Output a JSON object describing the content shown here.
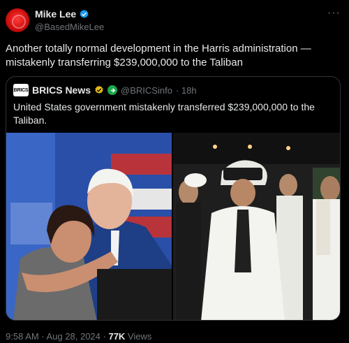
{
  "author": {
    "display_name": "Mike Lee",
    "handle": "@BasedMikeLee"
  },
  "more_icon": "ellipsis-icon",
  "tweet": {
    "text": "Another totally normal development in the Harris administration — mistakenly transferring $239,000,000 to the Taliban"
  },
  "quote": {
    "avatar_text": "BRICS",
    "name": "BRICS News",
    "handle": "@BRICSinfo",
    "time": "· 18h",
    "text": "United States government mistakenly transferred $239,000,000 to the Taliban.",
    "images": [
      "photo-left",
      "photo-right"
    ]
  },
  "footer": {
    "time": "9:58 AM",
    "sep1": " · ",
    "date": "Aug 28, 2024",
    "sep2": " · ",
    "views_count": "77K",
    "views_label": " Views"
  },
  "colors": {
    "verified_blue": "#1d9bf0",
    "verified_gold": "#e2b719",
    "secondary_text": "#71767b",
    "background": "#000000"
  }
}
